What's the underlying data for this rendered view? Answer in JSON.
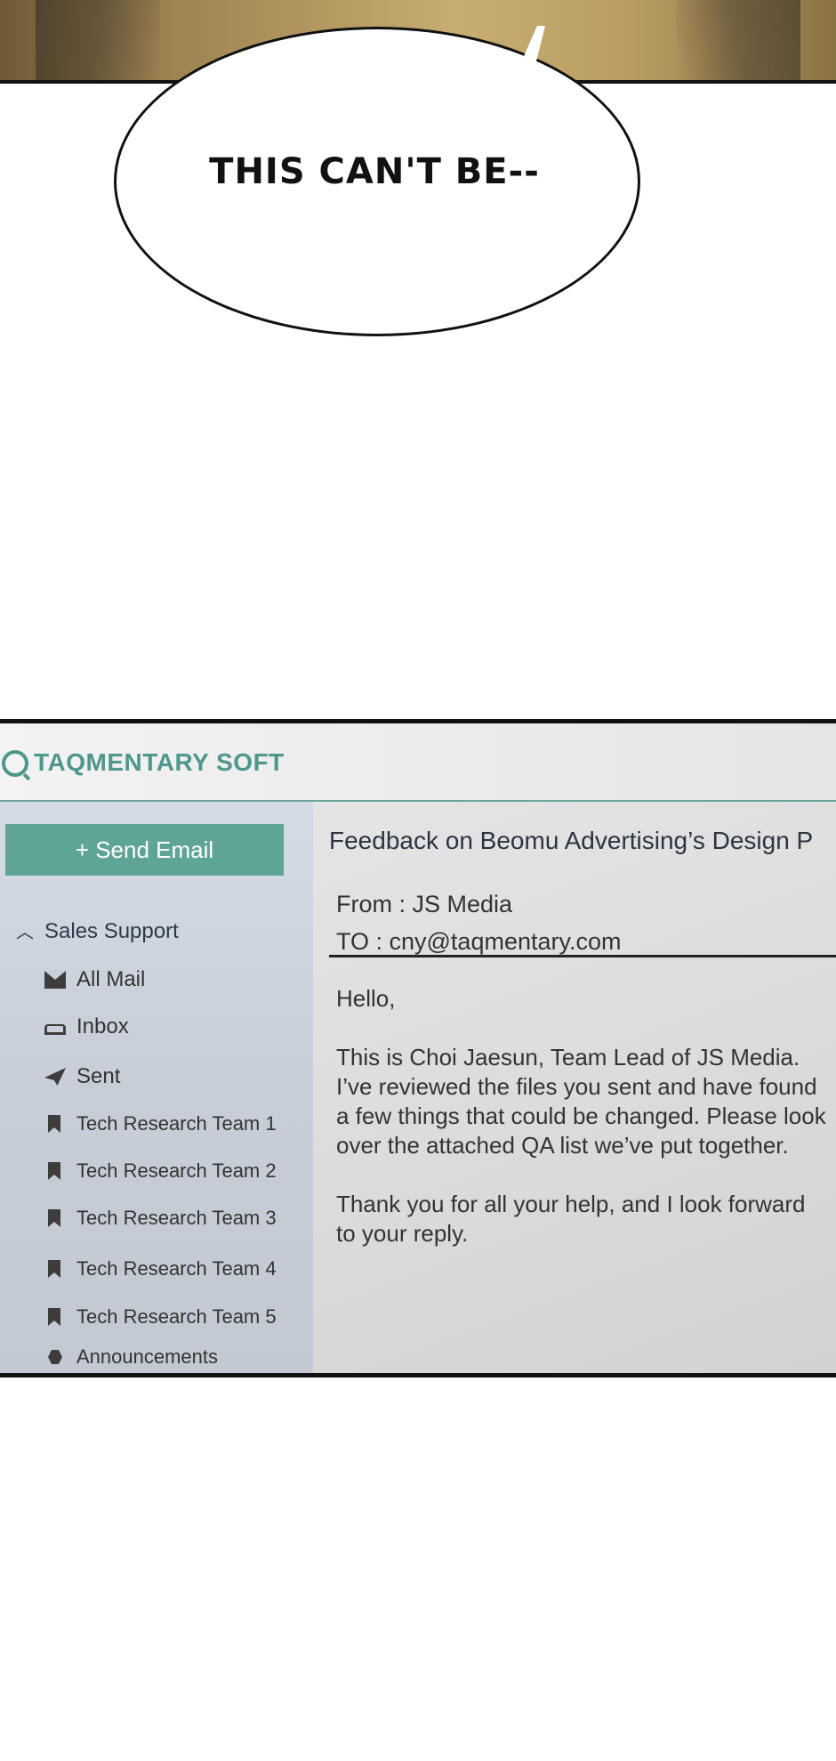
{
  "comic": {
    "speech": "THIS CAN'T BE--"
  },
  "app": {
    "brand": "TAQMENTARY SOFT",
    "send_button": "+ Send Email",
    "folder_group": "Sales Support",
    "folders": [
      {
        "label": "All Mail",
        "icon": "mail-icon"
      },
      {
        "label": "Inbox",
        "icon": "inbox-icon"
      },
      {
        "label": "Sent",
        "icon": "send-icon"
      },
      {
        "label": "Tech Research Team 1",
        "icon": "bookmark-icon"
      },
      {
        "label": "Tech Research Team 2",
        "icon": "bookmark-icon"
      },
      {
        "label": "Tech Research Team 3",
        "icon": "bookmark-icon"
      },
      {
        "label": "Tech Research Team 4",
        "icon": "bookmark-icon"
      },
      {
        "label": "Tech Research Team 5",
        "icon": "bookmark-icon"
      },
      {
        "label": "Announcements",
        "icon": "hexagon-icon"
      }
    ],
    "accent_color": "#5fa597"
  },
  "email": {
    "subject": "Feedback on Beomu Advertising’s Design P",
    "from": "From : JS Media",
    "to": "TO : cny@taqmentary.com",
    "greeting": "Hello,",
    "paragraph1": "This is Choi Jaesun, Team Lead of JS Media.\nI’ve reviewed the files you sent and have found a few things that could be changed. Please look over the attached QA list we’ve put together.",
    "paragraph2": "Thank you for all your help, and I look forward to your reply."
  }
}
